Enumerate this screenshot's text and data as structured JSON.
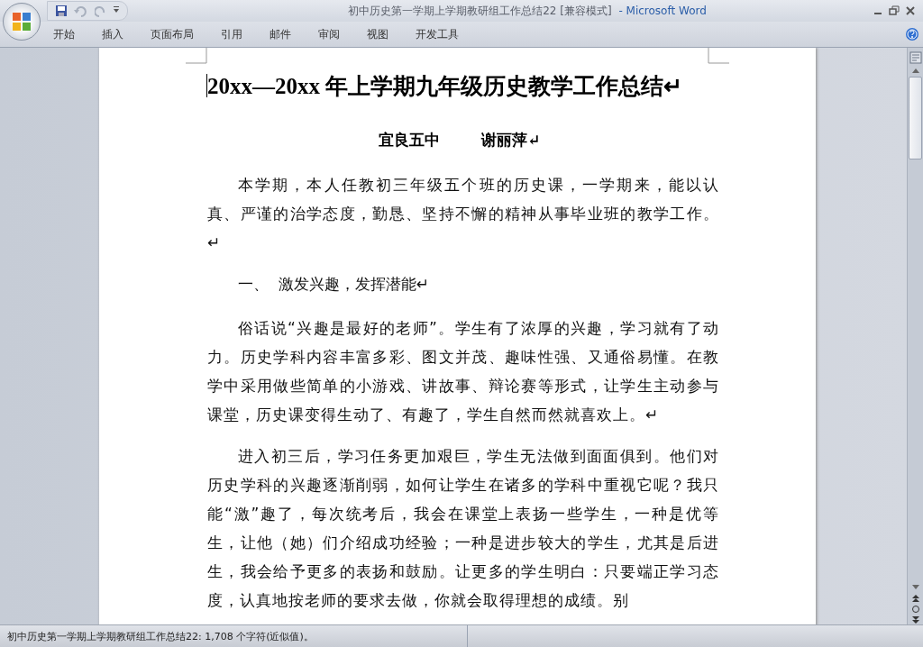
{
  "window": {
    "title": "初中历史第一学期上学期教研组工作总结22 [兼容模式]",
    "app": "- Microsoft Word"
  },
  "ribbon_tabs": [
    {
      "label": "开始"
    },
    {
      "label": "插入"
    },
    {
      "label": "页面布局"
    },
    {
      "label": "引用"
    },
    {
      "label": "邮件"
    },
    {
      "label": "审阅"
    },
    {
      "label": "视图"
    },
    {
      "label": "开发工具"
    }
  ],
  "document": {
    "title": "20xx—20xx 年上学期九年级历史教学工作总结↵",
    "author": [
      "宜良五中",
      "谢丽萍↵"
    ],
    "blocks": [
      {
        "kind": "paragraph",
        "text": "本学期，本人任教初三年级五个班的历史课，一学期来，能以认真、严谨的治学态度，勤恳、坚持不懈的精神从事毕业班的教学工作。↵"
      },
      {
        "kind": "heading",
        "text": "一、  激发兴趣，发挥潜能↵"
      },
      {
        "kind": "paragraph",
        "text": "俗话说“兴趣是最好的老师”。学生有了浓厚的兴趣，学习就有了动力。历史学科内容丰富多彩、图文并茂、趣味性强、又通俗易懂。在教学中采用做些简单的小游戏、讲故事、辩论赛等形式，让学生主动参与课堂，历史课变得生动了、有趣了，学生自然而然就喜欢上。↵"
      },
      {
        "kind": "paragraph",
        "text": "进入初三后，学习任务更加艰巨，学生无法做到面面俱到。他们对历史学科的兴趣逐渐削弱，如何让学生在诸多的学科中重视它呢？我只能“激”趣了，每次统考后，我会在课堂上表扬一些学生，一种是优等生，让他（她）们介绍成功经验；一种是进步较大的学生，尤其是后进生，我会给予更多的表扬和鼓励。让更多的学生明白：只要端正学习态度，认真地按老师的要求去做，你就会取得理想的成绩。别"
      }
    ]
  },
  "status_bar": {
    "text": "初中历史第一学期上学期教研组工作总结22: 1,708 个字符(近似值)。"
  }
}
